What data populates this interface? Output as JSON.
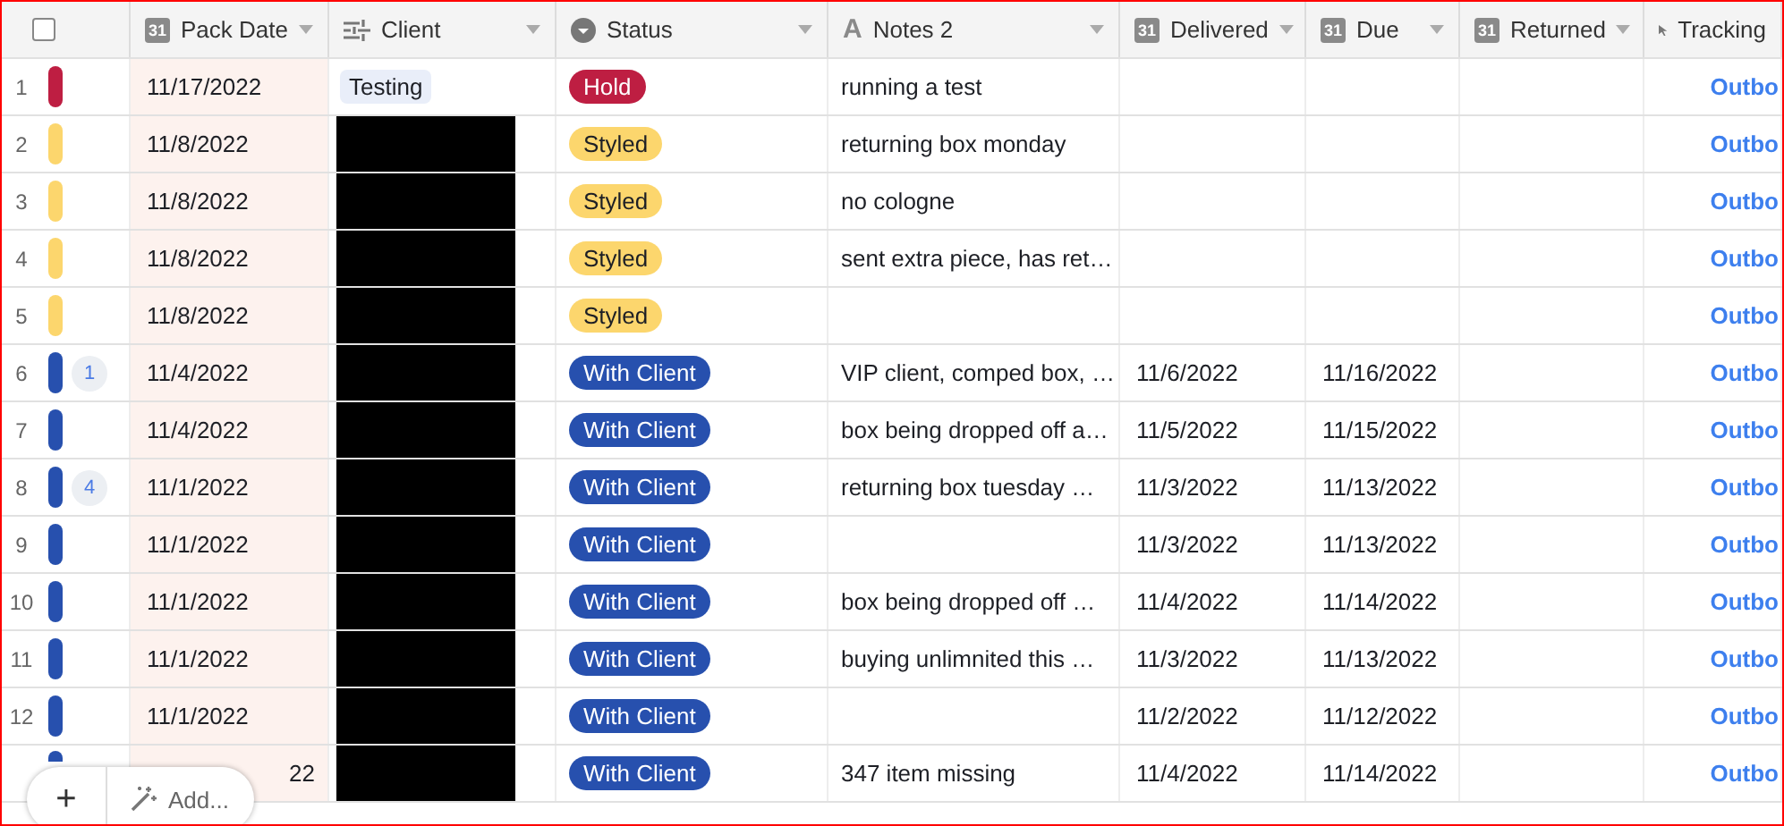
{
  "columns": [
    {
      "kind": "date",
      "icon_text": "31",
      "label": "Pack Date"
    },
    {
      "kind": "link",
      "label": "Client"
    },
    {
      "kind": "status",
      "label": "Status"
    },
    {
      "kind": "text",
      "icon_text": "A",
      "label": "Notes 2"
    },
    {
      "kind": "date",
      "icon_text": "31",
      "label": "Delivered"
    },
    {
      "kind": "date",
      "icon_text": "31",
      "label": "Due"
    },
    {
      "kind": "date",
      "icon_text": "31",
      "label": "Returned"
    },
    {
      "kind": "cursor",
      "label": "Tracking"
    }
  ],
  "rows": [
    {
      "number": "1",
      "color": "#be1e42",
      "pack_date": "11/17/2022",
      "client": "Testing",
      "client_redacted": false,
      "status": "Hold",
      "notes": "running a test",
      "tracking": "Outbo"
    },
    {
      "number": "2",
      "color": "#fcd66d",
      "pack_date": "11/8/2022",
      "client_redacted": true,
      "status": "Styled",
      "notes": "returning box monday",
      "tracking": "Outbo"
    },
    {
      "number": "3",
      "color": "#fcd66d",
      "pack_date": "11/8/2022",
      "client_redacted": true,
      "status": "Styled",
      "notes": "no cologne",
      "tracking": "Outbo"
    },
    {
      "number": "4",
      "color": "#fcd66d",
      "pack_date": "11/8/2022",
      "client_redacted": true,
      "status": "Styled",
      "notes": "sent extra piece, has ret…",
      "tracking": "Outbo"
    },
    {
      "number": "5",
      "color": "#fcd66d",
      "pack_date": "11/8/2022",
      "client_redacted": true,
      "status": "Styled",
      "tracking": "Outbo"
    },
    {
      "number": "6",
      "color": "#2750ae",
      "comments": "1",
      "pack_date": "11/4/2022",
      "client_redacted": true,
      "status": "With Client",
      "notes": "VIP client, comped box, …",
      "delivered": "11/6/2022",
      "due": "11/16/2022",
      "tracking": "Outbo"
    },
    {
      "number": "7",
      "color": "#2750ae",
      "pack_date": "11/4/2022",
      "client_redacted": true,
      "status": "With Client",
      "notes": "box being dropped off a…",
      "delivered": "11/5/2022",
      "due": "11/15/2022",
      "tracking": "Outbo"
    },
    {
      "number": "8",
      "color": "#2750ae",
      "comments": "4",
      "pack_date": "11/1/2022",
      "client_redacted": true,
      "status": "With Client",
      "notes": "returning box tuesday …",
      "delivered": "11/3/2022",
      "due": "11/13/2022",
      "tracking": "Outbo"
    },
    {
      "number": "9",
      "color": "#2750ae",
      "pack_date": "11/1/2022",
      "client_redacted": true,
      "status": "With Client",
      "delivered": "11/3/2022",
      "due": "11/13/2022",
      "tracking": "Outbo"
    },
    {
      "number": "10",
      "color": "#2750ae",
      "pack_date": "11/1/2022",
      "client_redacted": true,
      "status": "With Client",
      "notes": "box being dropped off …",
      "delivered": "11/4/2022",
      "due": "11/14/2022",
      "tracking": "Outbo"
    },
    {
      "number": "11",
      "color": "#2750ae",
      "pack_date": "11/1/2022",
      "client_redacted": true,
      "status": "With Client",
      "notes": "buying unlimnited this …",
      "delivered": "11/3/2022",
      "due": "11/13/2022",
      "tracking": "Outbo"
    },
    {
      "number": "12",
      "color": "#2750ae",
      "pack_date": "11/1/2022",
      "client_redacted": true,
      "status": "With Client",
      "delivered": "11/2/2022",
      "due": "11/12/2022",
      "tracking": "Outbo"
    },
    {
      "covered": true,
      "color": "#2750ae",
      "pack_date": "22",
      "client_redacted": true,
      "status": "With Client",
      "notes": "347 item missing",
      "delivered": "11/4/2022",
      "due": "11/14/2022",
      "tracking": "Outbo"
    }
  ],
  "select_all": {
    "checked": false
  },
  "add_bar": {
    "plus": "+",
    "label": "Add..."
  }
}
